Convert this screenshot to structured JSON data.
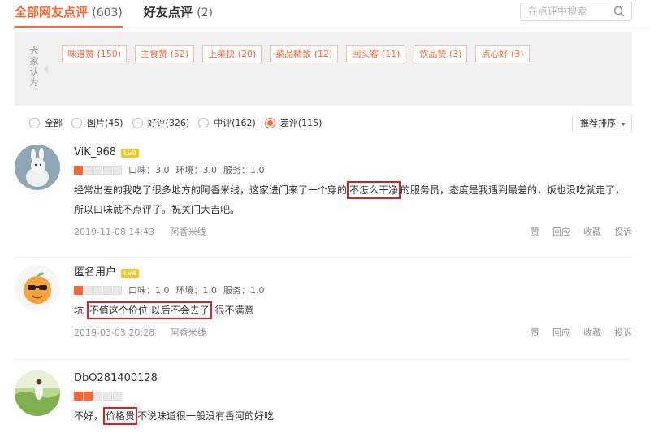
{
  "tabs": [
    {
      "label": "全部网友点评",
      "count": "(603)"
    },
    {
      "label": "好友点评",
      "count": "(2)"
    }
  ],
  "search": {
    "placeholder": "在点评中搜索"
  },
  "tag_panel": {
    "label": "大家认为",
    "tags": [
      "味道赞 (150)",
      "主食赞 (52)",
      "上菜快 (20)",
      "菜品精致 (12)",
      "回头客 (11)",
      "饮品赞 (3)",
      "点心好 (3)"
    ]
  },
  "filters": {
    "options": [
      "全部",
      "图片(45)",
      "好评(326)",
      "中评(162)",
      "差评(115)"
    ],
    "selected": "差评(115)"
  },
  "sort": {
    "label": "推荐排序"
  },
  "reviews": [
    {
      "user": "ViK_968",
      "level": "Lv3",
      "stars": 1,
      "taste": "口味：3.0",
      "env": "环境：3.0",
      "service": "服务：1.0",
      "text_a": "经常出差的我吃了很多地方的阿香米线，这家进门来了一个穿的",
      "text_hl": "不怎么干净",
      "text_b": "的服务员，态度是我遇到最差的，饭也没吃就走了，所以口味就不点评了。祝关门大吉吧。",
      "date": "2019-11-08 14:43",
      "shop": "阿香米线"
    },
    {
      "user": "匿名用户",
      "level": "Lv4",
      "stars": 1,
      "taste": "口味：1.0",
      "env": "环境：1.0",
      "service": "服务：1.0",
      "text_a": "坑 ",
      "text_hl": "不值这个价位 以后不会去了",
      "text_b": " 很不满意",
      "date": "2019-03-03 20:28",
      "shop": "阿香米线"
    },
    {
      "user": "DbO281400128",
      "stars": 2,
      "text_a": "不好，",
      "text_hl": "价格贵",
      "text_b": "不说味道很一般没有香河的好吃"
    }
  ],
  "actions": [
    "赞",
    "回应",
    "收藏",
    "投诉"
  ],
  "colors": {
    "accent": "#ff6633",
    "highlight_box": "#e01e1e",
    "level_badge": "#f7c61e"
  }
}
